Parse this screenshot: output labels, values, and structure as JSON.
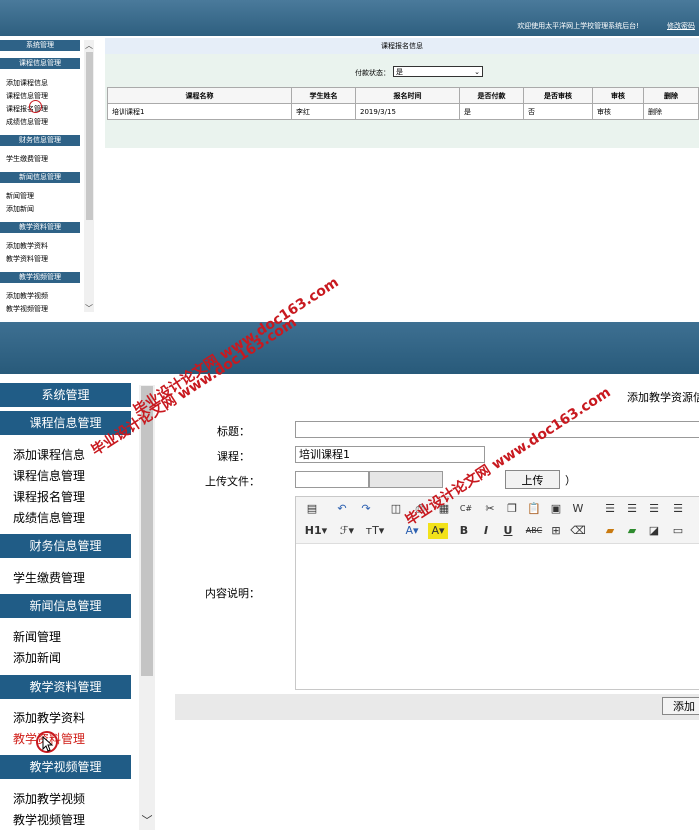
{
  "top": {
    "header": {
      "welcome": "欢迎使用太平洋网上学校管理系统后台!",
      "change_password": "修改密码"
    },
    "sidebar": {
      "sections": [
        {
          "title": "系统管理",
          "items": []
        },
        {
          "title": "课程信息管理",
          "items": [
            "添加课程信息",
            "课程信息管理",
            "课程报名管理",
            "成绩信息管理"
          ]
        },
        {
          "title": "财务信息管理",
          "items": [
            "学生缴费管理"
          ]
        },
        {
          "title": "新闻信息管理",
          "items": [
            "新闻管理",
            "添加新闻"
          ]
        },
        {
          "title": "教学资料管理",
          "items": [
            "添加教学资料",
            "教学资料管理"
          ]
        },
        {
          "title": "教学视频管理",
          "items": [
            "添加教学视频",
            "教学视频管理"
          ]
        }
      ]
    },
    "main": {
      "title": "课程报名信息",
      "filter_label": "付款状态：",
      "filter_value": "是",
      "columns": [
        "课程名称",
        "学生姓名",
        "报名时间",
        "是否付款",
        "是否审核",
        "审核",
        "删除"
      ],
      "rows": [
        [
          "培训课程1",
          "李红",
          "2019/3/15",
          "是",
          "否",
          "审核",
          "删除"
        ]
      ]
    }
  },
  "bottom": {
    "sidebar": {
      "sections": [
        {
          "title": "系统管理",
          "items": []
        },
        {
          "title": "课程信息管理",
          "items": [
            "添加课程信息",
            "课程信息管理",
            "课程报名管理",
            "成绩信息管理"
          ]
        },
        {
          "title": "财务信息管理",
          "items": [
            "学生缴费管理"
          ]
        },
        {
          "title": "新闻信息管理",
          "items": [
            "新闻管理",
            "添加新闻"
          ]
        },
        {
          "title": "教学资料管理",
          "items": [
            "添加教学资料",
            "教学资料管理"
          ]
        },
        {
          "title": "教学视频管理",
          "items": [
            "添加教学视频",
            "教学视频管理"
          ]
        }
      ],
      "active_item": "教学资料管理"
    },
    "form": {
      "page_title": "添加教学资源信",
      "title_label": "标题：",
      "title_value": "",
      "course_label": "课程：",
      "course_value": "培训课程1",
      "upload_label": "上传文件：",
      "upload_button": "上传",
      "upload_suffix": "）",
      "content_label": "内容说明：",
      "add_button": "添加"
    },
    "toolbar": {
      "row1": [
        "源码",
        "撤销",
        "重做",
        "预览",
        "打印",
        "模板",
        "代码",
        "剪切",
        "复制",
        "粘贴",
        "粘贴为文本",
        "从Word粘贴",
        "左对齐",
        "居中",
        "右对齐",
        "两端对齐"
      ],
      "row2": [
        "H1",
        "字体",
        "字号",
        "文字颜色",
        "背景颜色",
        "B",
        "I",
        "U",
        "ABC",
        "表格",
        "清除格式",
        "图片",
        "多图",
        "Flash",
        "媒体"
      ]
    }
  },
  "watermark": "毕业设计论文网 www.doc163.com"
}
